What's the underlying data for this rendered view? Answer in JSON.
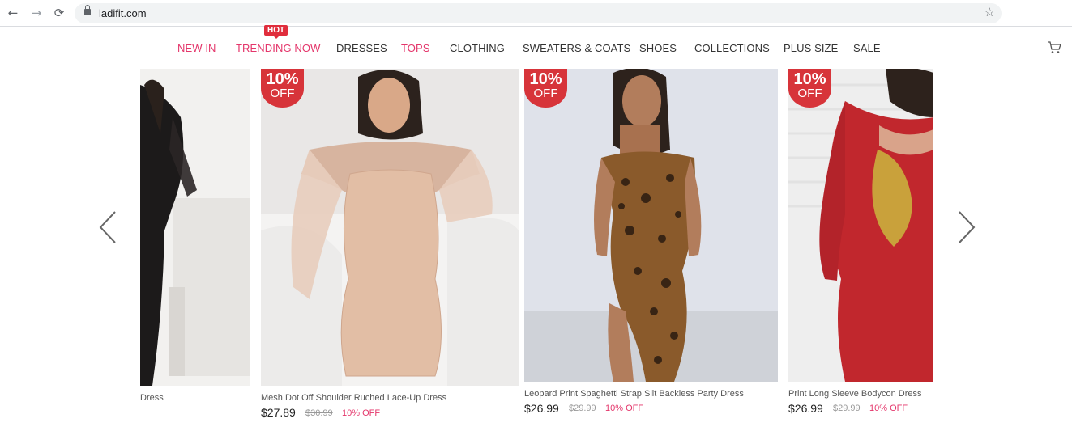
{
  "browser": {
    "url": "ladifit.com"
  },
  "nav": {
    "items": [
      {
        "label": "NEW IN"
      },
      {
        "label": "TRENDING NOW"
      },
      {
        "label": "DRESSES"
      },
      {
        "label": "TOPS"
      },
      {
        "label": "CLOTHING"
      },
      {
        "label": "SWEATERS & COATS"
      },
      {
        "label": "SHOES"
      },
      {
        "label": "COLLECTIONS"
      },
      {
        "label": "PLUS SIZE"
      },
      {
        "label": "SALE"
      }
    ],
    "hot_badge": "HOT"
  },
  "colors": {
    "accent": "#e4366b",
    "badge": "#d7343a"
  },
  "badge": {
    "pct": "10%",
    "off": "OFF"
  },
  "products": [
    {
      "name": "Dress"
    },
    {
      "name": "Mesh Dot Off Shoulder Ruched Lace-Up Dress",
      "price": "$27.89",
      "old_price": "$30.99",
      "discount": "10% OFF"
    },
    {
      "name": "Leopard Print Spaghetti Strap Slit Backless Party Dress",
      "price": "$26.99",
      "old_price": "$29.99",
      "discount": "10% OFF"
    },
    {
      "name": "Print Long Sleeve Bodycon Dress",
      "price": "$26.99",
      "old_price": "$29.99",
      "discount": "10% OFF"
    }
  ]
}
